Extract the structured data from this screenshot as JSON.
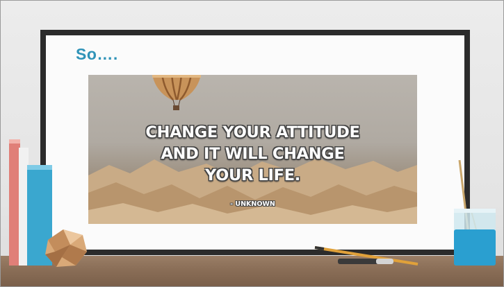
{
  "slide": {
    "heading": "So….",
    "quote": {
      "line1": "CHANGE YOUR ATTITUDE",
      "line2": "AND IT WILL CHANGE",
      "line3": "YOUR LIFE.",
      "author": "- UNKNOWN"
    }
  },
  "colors": {
    "heading": "#2f93b8",
    "frame": "#2b2b2b",
    "desk": "#8a6e57"
  }
}
